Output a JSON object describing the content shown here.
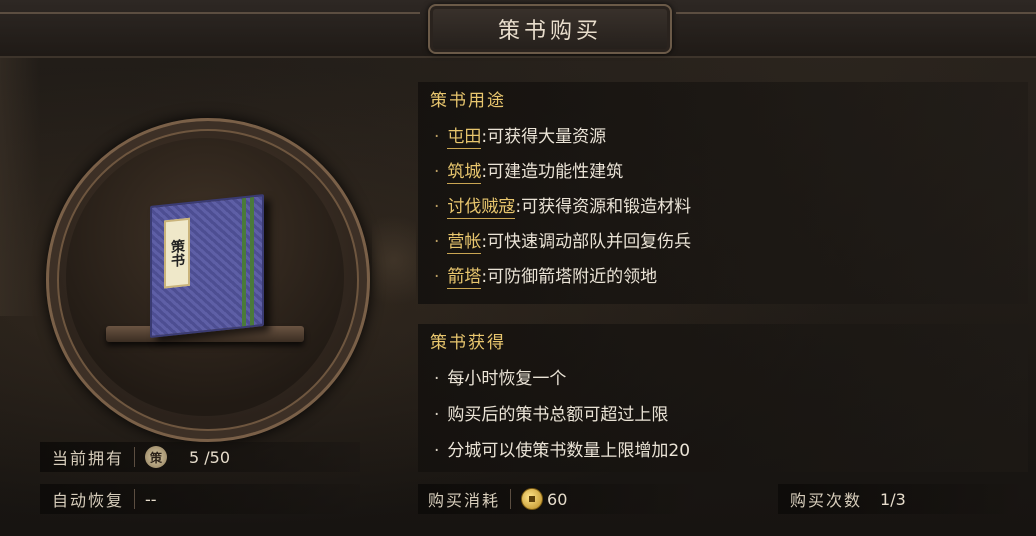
{
  "header": {
    "title": "策书购买"
  },
  "book": {
    "label": "策书"
  },
  "usage": {
    "title": "策书用途",
    "items": [
      {
        "bullet": "·",
        "keyword": "屯田",
        "text": ":可获得大量资源"
      },
      {
        "bullet": "·",
        "keyword": "筑城",
        "text": ":可建造功能性建筑"
      },
      {
        "bullet": "·",
        "keyword": "讨伐贼寇",
        "text": ":可获得资源和锻造材料"
      },
      {
        "bullet": "·",
        "keyword": "营帐",
        "text": ":可快速调动部队并回复伤兵"
      },
      {
        "bullet": "·",
        "keyword": "箭塔",
        "text": ":可防御箭塔附近的领地"
      }
    ]
  },
  "obtain": {
    "title": "策书获得",
    "items": [
      {
        "bullet": "·",
        "text": "每小时恢复一个"
      },
      {
        "bullet": "·",
        "text": "购买后的策书总额可超过上限"
      },
      {
        "bullet": "·",
        "text": "分城可以使策书数量上限增加20"
      }
    ]
  },
  "status": {
    "owned_label": "当前拥有",
    "owned_badge": "策",
    "owned_value": "5 /50",
    "recover_label": "自动恢复",
    "recover_value": "--"
  },
  "purchase": {
    "cost_label": "购买消耗",
    "cost_value": "60",
    "count_label": "购买次数",
    "count_value": "1/3"
  },
  "colors": {
    "accent_gold": "#e8c66e",
    "background": "#1d1915",
    "book_blue": "#5e5fa6"
  }
}
